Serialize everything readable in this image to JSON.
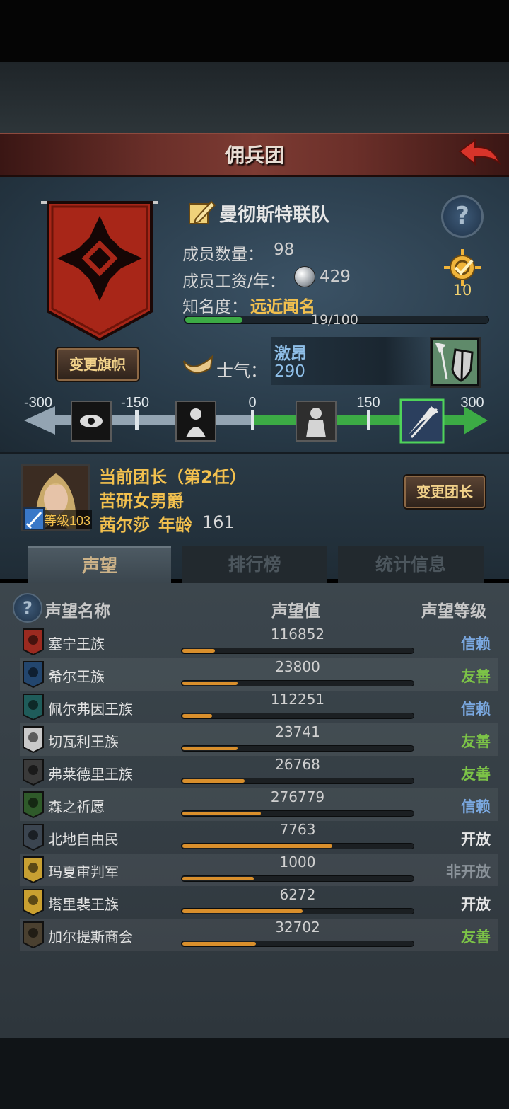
{
  "header": {
    "title": "佣兵团"
  },
  "mercenary": {
    "name": "曼彻斯特联队",
    "members_label": "成员数量：",
    "members": "98",
    "wage_label": "成员工资/年：",
    "wage": "429",
    "fame_label": "知名度：",
    "fame_value": "远近闻名",
    "fame_progress": "19/100",
    "fame_fraction": 0.19,
    "medal_count": "10",
    "change_flag_button": "变更旗帜",
    "morale_label": "士气：",
    "morale_state": "激昂",
    "morale_value": "290"
  },
  "morale_scale": {
    "ticks": [
      "-300",
      "-150",
      "0",
      "150",
      "300"
    ],
    "value": 290
  },
  "leader": {
    "title": "当前团长（第2任）",
    "rank": "苦研女男爵",
    "name": "茜尔莎",
    "age_label": "年龄",
    "age": "161",
    "level_label": "等级103",
    "change_button": "变更团长"
  },
  "tabs": [
    {
      "label": "声望"
    },
    {
      "label": "排行榜"
    },
    {
      "label": "统计信息"
    }
  ],
  "table": {
    "headers": {
      "name": "声望名称",
      "value": "声望值",
      "level": "声望等级"
    },
    "rows": [
      {
        "name": "塞宁王族",
        "value": "116852",
        "fraction": 0.14,
        "level": "信赖",
        "level_color": "#7aa8e0",
        "icon_color": "#9b2a20",
        "icon": "dragon-crest-icon"
      },
      {
        "name": "希尔王族",
        "value": "23800",
        "fraction": 0.24,
        "level": "友善",
        "level_color": "#7cc347",
        "icon_color": "#23466e",
        "icon": "helm-crest-icon"
      },
      {
        "name": "佩尔弗因王族",
        "value": "112251",
        "fraction": 0.13,
        "level": "信赖",
        "level_color": "#7aa8e0",
        "icon_color": "#1f5c5a",
        "icon": "serpent-crest-icon"
      },
      {
        "name": "切瓦利王族",
        "value": "23741",
        "fraction": 0.24,
        "level": "友善",
        "level_color": "#7cc347",
        "icon_color": "#c9c9c9",
        "icon": "scales-crest-icon"
      },
      {
        "name": "弗莱德里王族",
        "value": "26768",
        "fraction": 0.27,
        "level": "友善",
        "level_color": "#7cc347",
        "icon_color": "#3a3a3a",
        "icon": "wolf-crest-icon"
      },
      {
        "name": "森之祈愿",
        "value": "276779",
        "fraction": 0.34,
        "level": "信赖",
        "level_color": "#7aa8e0",
        "icon_color": "#2f5a2a",
        "icon": "tree-crest-icon"
      },
      {
        "name": "北地自由民",
        "value": "7763",
        "fraction": 0.65,
        "level": "开放",
        "level_color": "#e6e6e6",
        "icon_color": "#3b4550",
        "icon": "beast-crest-icon"
      },
      {
        "name": "玛夏审判军",
        "value": "1000",
        "fraction": 0.31,
        "level": "非开放",
        "level_color": "#8a9299",
        "icon_color": "#c8a032",
        "icon": "sun-crest-icon"
      },
      {
        "name": "塔里裴王族",
        "value": "6272",
        "fraction": 0.52,
        "level": "开放",
        "level_color": "#e6e6e6",
        "icon_color": "#caa030",
        "icon": "crown-crest-icon"
      },
      {
        "name": "加尔提斯商会",
        "value": "32702",
        "fraction": 0.32,
        "level": "友善",
        "level_color": "#7cc347",
        "icon_color": "#4a4030",
        "icon": "chest-crest-icon"
      }
    ]
  }
}
